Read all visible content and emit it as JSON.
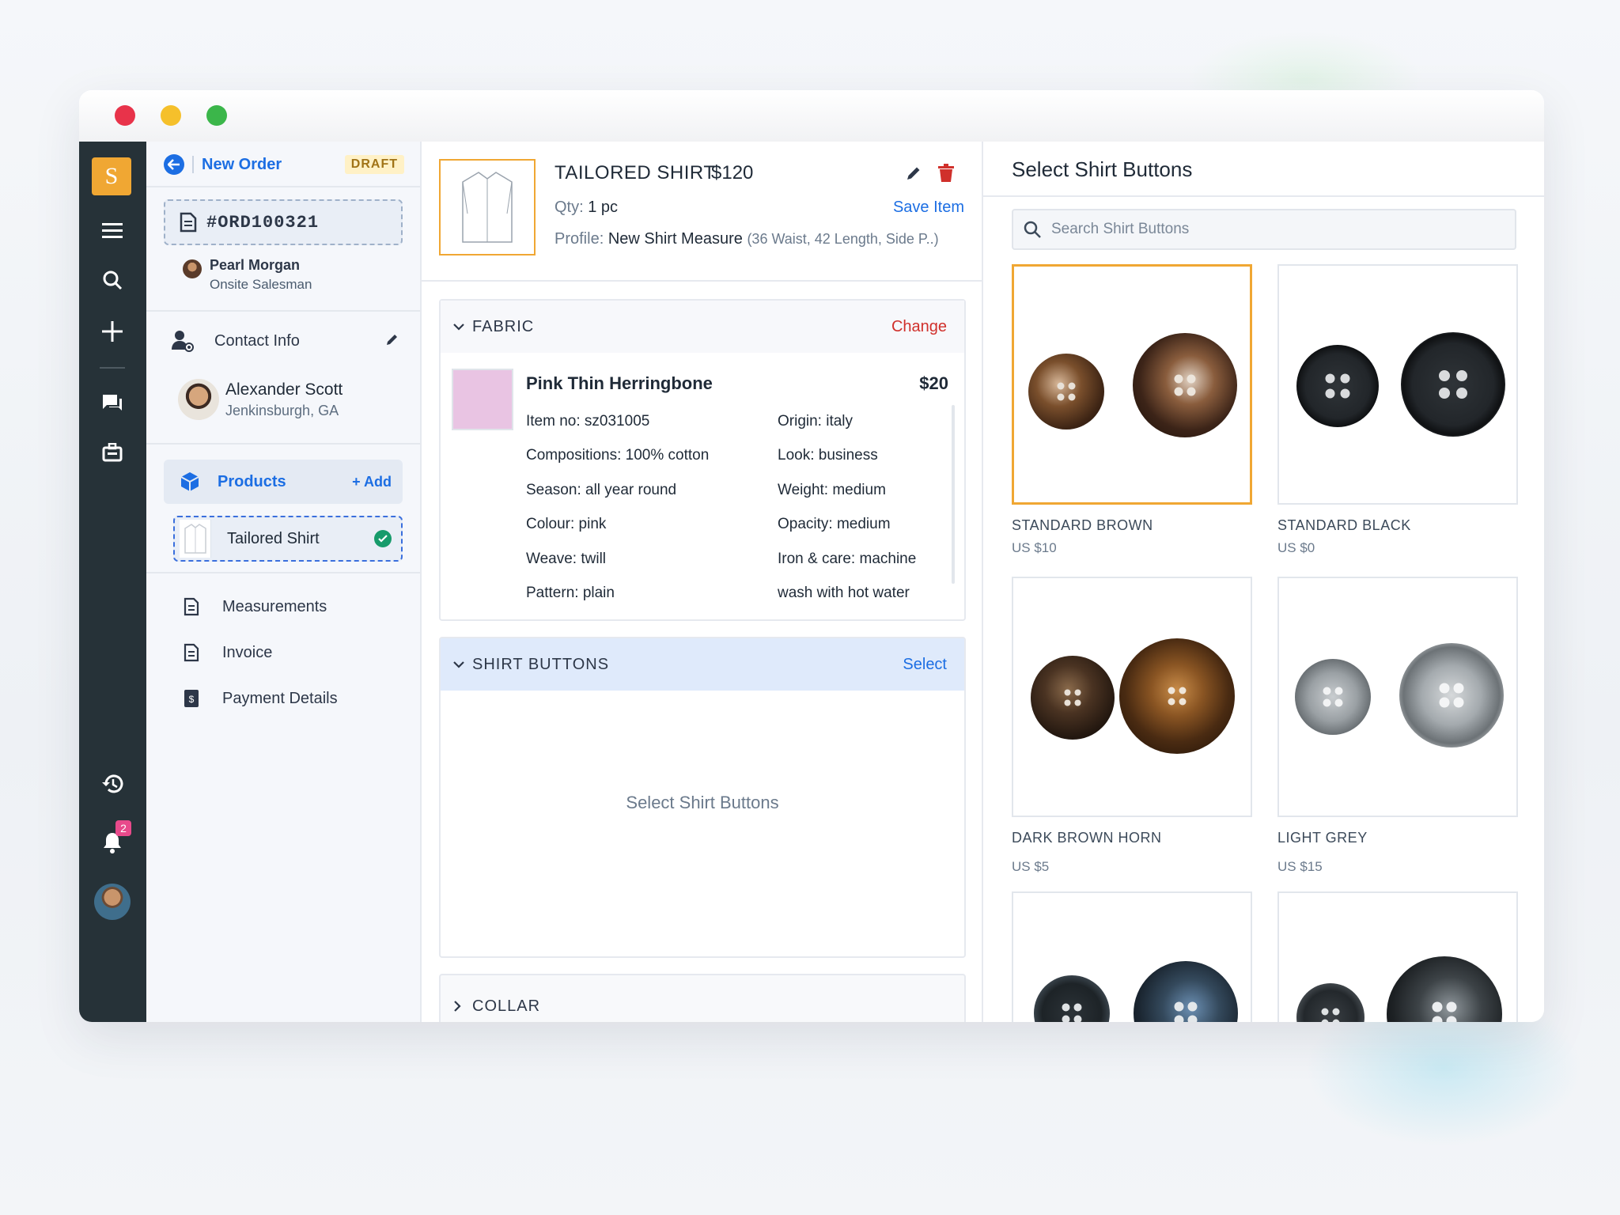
{
  "sidebar_rail": {
    "logo_letter": "S",
    "icons": [
      "menu-icon",
      "search-icon",
      "plus-icon",
      "chat-icon",
      "briefcase-icon",
      "history-icon",
      "bell-icon"
    ],
    "notification_count": "2"
  },
  "order": {
    "title": "New Order",
    "status": "DRAFT",
    "number": "#ORD100321",
    "salesman_name": "Pearl Morgan",
    "salesman_role": "Onsite Salesman"
  },
  "left_nav": {
    "contact_info": "Contact Info",
    "customer_name": "Alexander Scott",
    "customer_location": "Jenkinsburgh, GA",
    "products": "Products",
    "add": "+ Add",
    "product_item": "Tailored Shirt",
    "measurements": "Measurements",
    "invoice": "Invoice",
    "payment_details": "Payment Details"
  },
  "product": {
    "title": "TAILORED SHIRT",
    "price": "$120",
    "qty_label": "Qty:",
    "qty_value": "1 pc",
    "save_item": "Save Item",
    "profile_label": "Profile:",
    "profile_value": "New Shirt Measure",
    "profile_detail": "(36 Waist, 42 Length, Side P..)"
  },
  "fabric": {
    "section": "FABRIC",
    "change": "Change",
    "name": "Pink Thin Herringbone",
    "price": "$20",
    "swatch_color": "#e9c4e3",
    "attributes_left": [
      "Item no: sz031005",
      "Compositions: 100% cotton",
      "Season: all year round",
      "Colour: pink",
      "Weave: twill",
      "Pattern: plain"
    ],
    "attributes_right": [
      "Origin: italy",
      "Look: business",
      "Weight: medium",
      "Opacity: medium",
      "Iron & care: machine",
      "wash with hot water"
    ]
  },
  "shirt_buttons": {
    "section": "SHIRT BUTTONS",
    "select": "Select",
    "placeholder": "Select Shirt Buttons"
  },
  "collar": {
    "section": "COLLAR"
  },
  "picker": {
    "title": "Select Shirt Buttons",
    "search_placeholder": "Search Shirt Buttons",
    "items": [
      {
        "name": "STANDARD BROWN",
        "price": "US $10",
        "selected": true
      },
      {
        "name": "STANDARD BLACK",
        "price": "US $0",
        "selected": false
      },
      {
        "name": "DARK BROWN HORN",
        "price": "US $5",
        "selected": false
      },
      {
        "name": "LIGHT GREY",
        "price": "US $15",
        "selected": false
      },
      {
        "name": "",
        "price": "",
        "selected": false
      },
      {
        "name": "",
        "price": "",
        "selected": false
      }
    ]
  },
  "colors": {
    "accent_blue": "#1c6ee3",
    "accent_orange": "#f0a733",
    "danger_red": "#d0302b",
    "success_green": "#179b6b",
    "rail_dark": "#263238"
  }
}
